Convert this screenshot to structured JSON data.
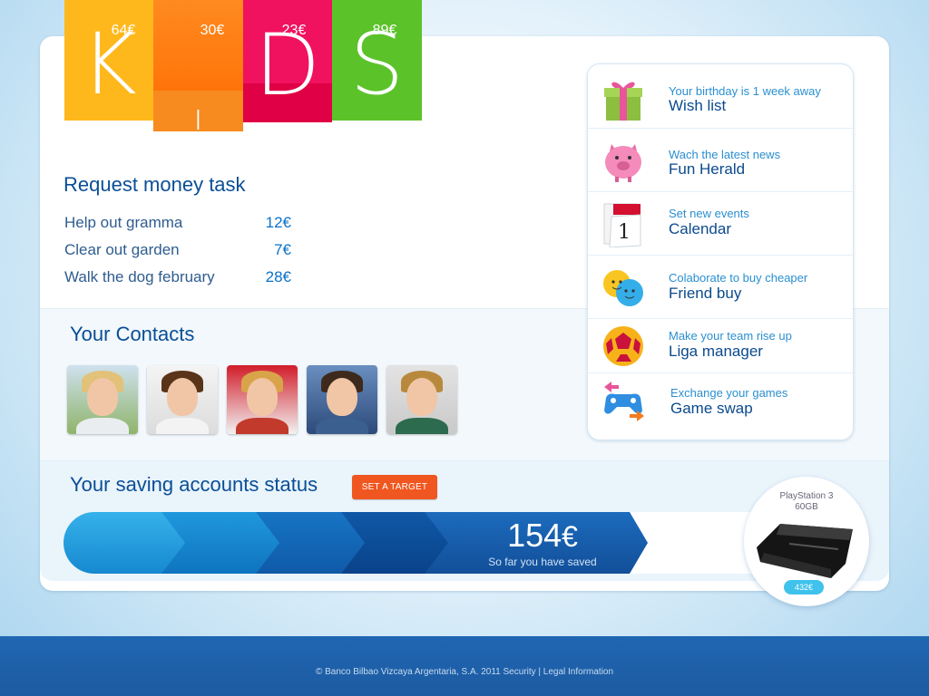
{
  "logo": {
    "letters": [
      "K",
      "ı",
      "D",
      "S"
    ],
    "colors": [
      "#ffb81c",
      "#ff7a10",
      "#f0115f",
      "#5cc22a"
    ]
  },
  "tasks": {
    "title": "Request money task",
    "items": [
      {
        "name": "Help out gramma",
        "amount": "12€"
      },
      {
        "name": "Clear out garden",
        "amount": "7€"
      },
      {
        "name": "Walk the dog february",
        "amount": "28€"
      }
    ]
  },
  "contacts": {
    "title": "Your Contacts",
    "items": [
      "contact-1",
      "contact-2",
      "contact-3",
      "contact-4",
      "contact-5"
    ]
  },
  "saving": {
    "title": "Your saving accounts status",
    "target_button": "SET A TARGET",
    "segments": [
      "64€",
      "30€",
      "23€",
      "89€"
    ],
    "total_value": "154",
    "total_currency": "€",
    "total_caption": "So far you have saved",
    "product_name_line1": "PlayStation 3",
    "product_name_line2": "60GB",
    "product_price": "432€"
  },
  "sidebar": {
    "items": [
      {
        "sub": "Your birthday is 1 week away",
        "main": "Wish list",
        "icon": "gift-icon"
      },
      {
        "sub": "Wach the latest news",
        "main": "Fun Herald",
        "icon": "pig-icon"
      },
      {
        "sub": "Set new events",
        "main": "Calendar",
        "icon": "calendar-icon"
      },
      {
        "sub": "Colaborate to buy cheaper",
        "main": "Friend buy",
        "icon": "friends-icon"
      },
      {
        "sub": "Make your team rise up",
        "main": "Liga manager",
        "icon": "soccer-ball-icon"
      },
      {
        "sub": "Exchange your games",
        "main": "Game swap",
        "icon": "gamepad-icon"
      }
    ],
    "calendar_day": "1"
  },
  "footer": {
    "text": "© Banco Bilbao Vizcaya Argentaria, S.A. 2011 Security | Legal Information"
  }
}
